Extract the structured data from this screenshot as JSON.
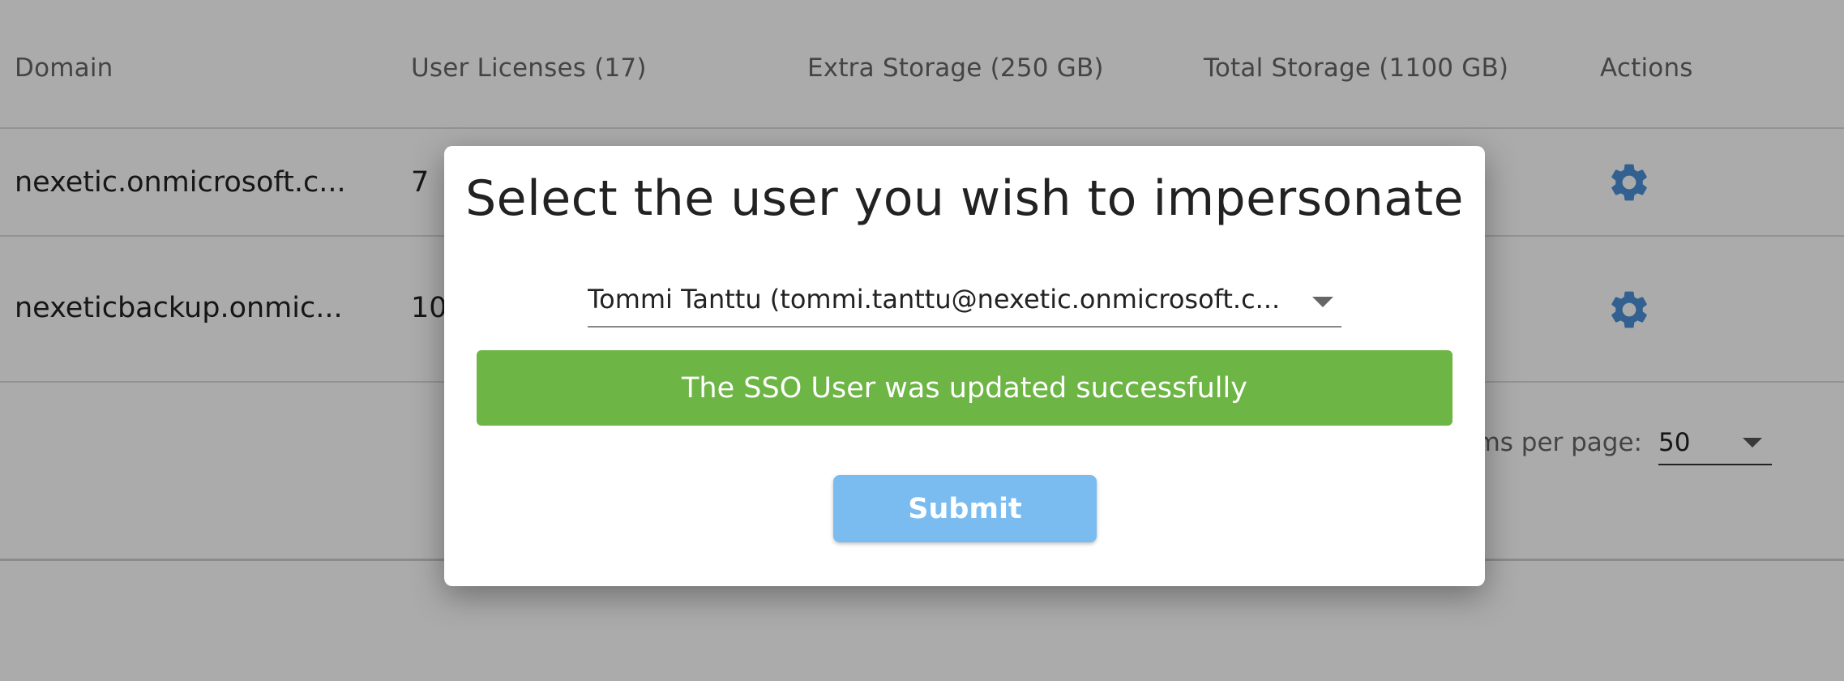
{
  "table": {
    "headers": {
      "domain": "Domain",
      "user_licenses": "User Licenses (17)",
      "extra_storage": "Extra Storage (250 GB)",
      "total_storage": "Total Storage (1100 GB)",
      "actions": "Actions"
    },
    "rows": [
      {
        "domain": "nexetic.onmicrosoft.c...",
        "licenses": "7",
        "action_icon": "gear-icon"
      },
      {
        "domain": "nexeticbackup.onmic...",
        "licenses": "10",
        "action_icon": "gear-icon"
      }
    ]
  },
  "pagination": {
    "items_per_page_label": "ms per page:",
    "items_per_page_value": "50"
  },
  "modal": {
    "title": "Select the user you wish to impersonate",
    "user_select_value": "Tommi Tanttu  (tommi.tanttu@nexetic.onmicrosoft.c...",
    "success_message": "The SSO User was updated successfully",
    "submit_label": "Submit"
  },
  "colors": {
    "success": "#6db544",
    "submit": "#7bbcf0",
    "gear": "#4a90d9"
  }
}
